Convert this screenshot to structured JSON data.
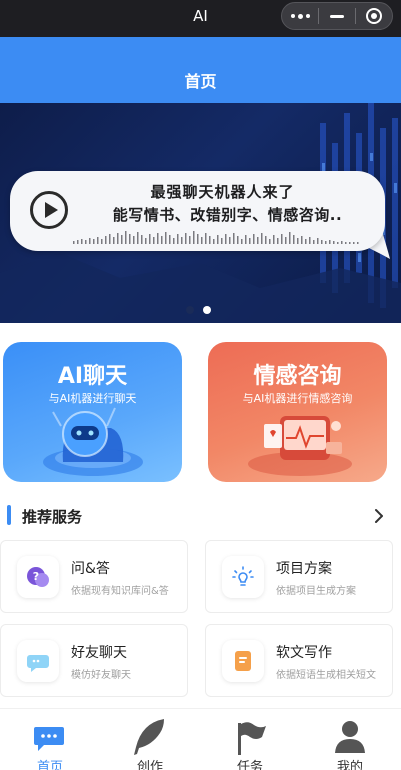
{
  "window": {
    "title": "AI"
  },
  "capsule": {
    "more_icon": "more-dots-icon",
    "minimize_icon": "minus-icon",
    "close_icon": "target-circle-icon"
  },
  "header": {
    "title": "首页"
  },
  "banner": {
    "line1": "最强聊天机器人来了",
    "line2": "能写情书、改错别字、情感咨询..",
    "play_icon": "play-icon",
    "pager": {
      "count": 2,
      "active": 2
    }
  },
  "feature_cards": [
    {
      "title": "AI聊天",
      "subtitle": "与AI机器进行聊天",
      "color": "#3a8ff7"
    },
    {
      "title": "情感咨询",
      "subtitle": "与AI机器进行情感咨询",
      "color": "#ed6c55"
    }
  ],
  "section": {
    "title": "推荐服务",
    "more_icon": "chevron-right-icon"
  },
  "services": [
    {
      "title": "问&答",
      "desc": "依据现有知识库问&答",
      "icon": "chat-question-icon"
    },
    {
      "title": "项目方案",
      "desc": "依据项目生成方案",
      "icon": "lightbulb-icon"
    },
    {
      "title": "好友聊天",
      "desc": "模仿好友聊天",
      "icon": "friend-chat-icon"
    },
    {
      "title": "软文写作",
      "desc": "依据短语生成相关短文",
      "icon": "document-icon"
    }
  ],
  "tabs": [
    {
      "label": "首页",
      "icon": "chat-bubble-icon",
      "active": true
    },
    {
      "label": "创作",
      "icon": "feather-icon",
      "active": false
    },
    {
      "label": "任务",
      "icon": "flag-icon",
      "active": false
    },
    {
      "label": "我的",
      "icon": "user-icon",
      "active": false
    }
  ],
  "colors": {
    "primary": "#3c8cf3",
    "topbar": "#1e1e22",
    "banner_bg": "#0e1d4a",
    "card_ai": "#3a8ff7",
    "card_emotion": "#ed6c55"
  }
}
